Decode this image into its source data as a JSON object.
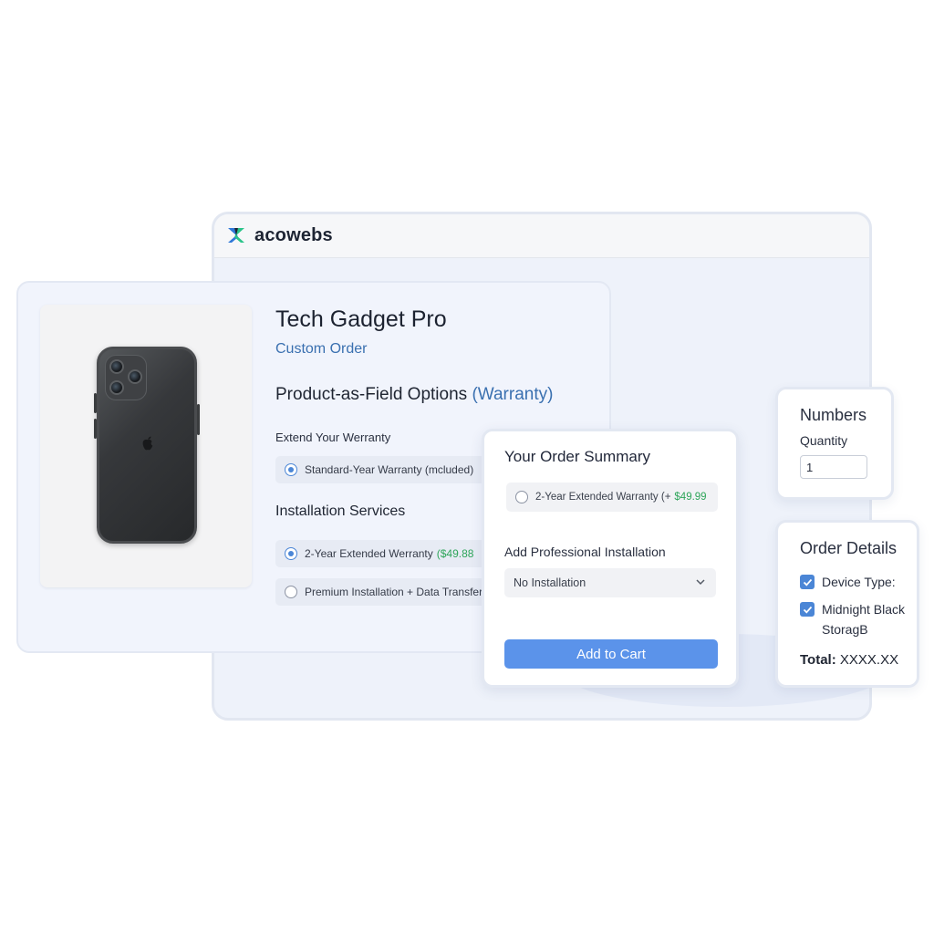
{
  "brand": {
    "name": "acowebs",
    "colors": {
      "primary": "#1d2433",
      "accent_green": "#2bc48a",
      "accent_blue": "#2f78d8"
    }
  },
  "product": {
    "title": "Tech Gadget Pro",
    "subtitle": "Custom Order",
    "options_heading": "Product-as-Field Options",
    "options_heading_accent": "(Warranty)",
    "warranty_label": "Extend Your Werranty",
    "warranty_option": "Standard-Year Warranty (mcluded)",
    "installation_heading": "Installation Services",
    "installation_options": [
      {
        "label": "2-Year Extended Werranty",
        "price": "($49.88",
        "checked": true
      },
      {
        "label": "Premium Installation + Data Transfer",
        "price": "",
        "checked": false
      }
    ],
    "image_icon": "smartphone-image"
  },
  "summary": {
    "title": "Your Order Summary",
    "warranty_option": {
      "label": "2-Year Extended Warranty (+",
      "price": "$49.99",
      "checked": false
    },
    "install_label": "Add Professional Installation",
    "install_select": "No Installation",
    "add_to_cart": "Add to Cart",
    "button_color": "#5b93ea"
  },
  "numbers": {
    "title": "Numbers",
    "quantity_label": "Quantity",
    "quantity_value": "1"
  },
  "details": {
    "title": "Order Details",
    "items": [
      {
        "label": "Device Type:",
        "label2": "",
        "checked": true
      },
      {
        "label": "Midnight Black",
        "label2": "StoragB",
        "checked": true
      }
    ],
    "total_label": "Total:",
    "total_value": "XXXX.XX"
  }
}
